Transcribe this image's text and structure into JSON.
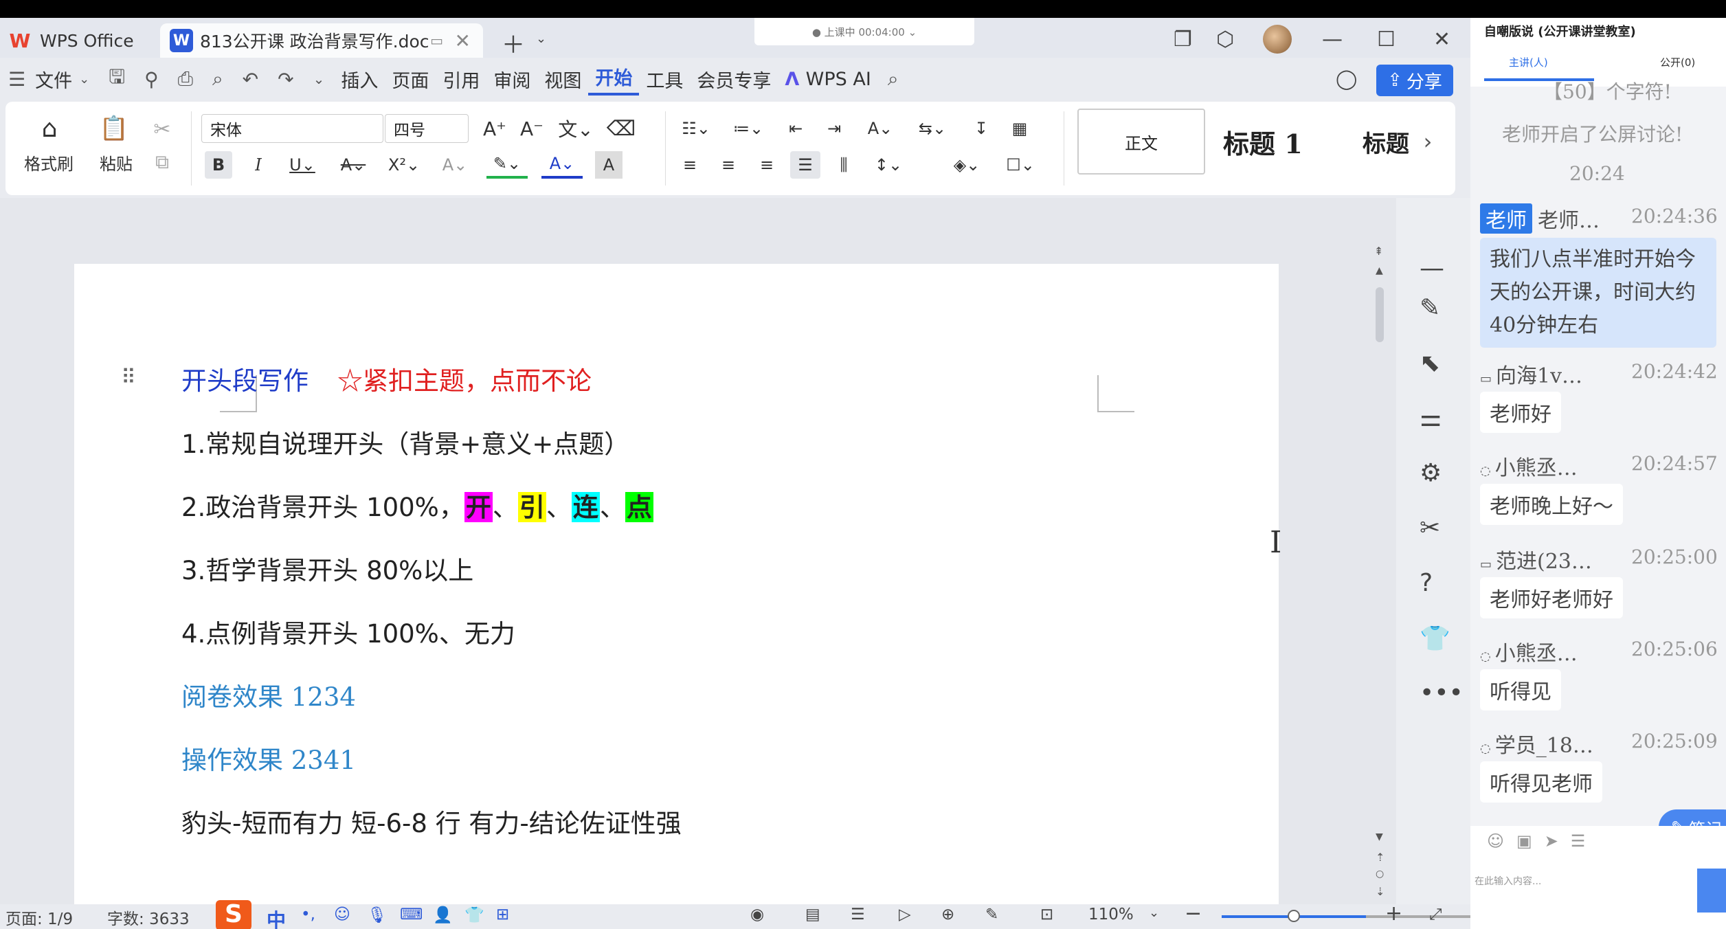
{
  "titlebar": {
    "home_tab": "WPS Office",
    "doc_tab": "813公开课 政治背景写作.doc",
    "timer": "● 上课中 00:04:00 ⌄"
  },
  "menu": {
    "file": "文件",
    "items": [
      "插入",
      "页面",
      "引用",
      "审阅",
      "视图",
      "开始",
      "工具",
      "会员专享"
    ],
    "active": "开始",
    "ai": "WPS AI",
    "share": "分享"
  },
  "ribbon": {
    "format_painter": "格式刷",
    "paste": "粘贴",
    "font_name": "宋体",
    "font_size": "四号",
    "style_normal": "正文",
    "style_h1": "标题 1",
    "style_h": "标题"
  },
  "document": {
    "heading_blue": "开头段写作",
    "heading_red": "☆紧扣主题，点而不论",
    "line1": "1.常规自说理开头（背景+意义+点题）",
    "line2_prefix": "2.政治背景开头 100%，",
    "hl1": "开",
    "hl2": "引",
    "hl3": "连",
    "hl4": "点",
    "sep": "、",
    "line3": "3.哲学背景开头 80%以上",
    "line4": "4.点例背景开头 100%、无力",
    "line5": "阅卷效果 1234",
    "line6": "操作效果 2341",
    "line7": "豹头-短而有力  短-6-8 行    有力-结论佐证性强"
  },
  "statusbar": {
    "page": "页面: 1/9",
    "words": "字数: 3633",
    "zoom": "110%",
    "ime": "中"
  },
  "zoom_level_fraction": 0.5,
  "chat": {
    "header_title": "自嘲版说 (公开课讲堂教室)",
    "tab_left": "主讲(人)",
    "tab_right": "公开(0)",
    "sys1": "【50】个字符!",
    "sys2": "老师开启了公屏讨论!",
    "sys_time": "20:24",
    "teacher_badge": "老师",
    "messages": [
      {
        "name": "老师…",
        "time": "20:24:36",
        "text": "我们八点半准时开始今天的公开课，时间大约40分钟左右"
      },
      {
        "name": "向海1v…",
        "time": "20:24:42",
        "text": "老师好"
      },
      {
        "name": "小熊丞…",
        "time": "20:24:57",
        "text": "老师晚上好～"
      },
      {
        "name": "范进(23…",
        "time": "20:25:00",
        "text": "老师好老师好"
      },
      {
        "name": "小熊丞…",
        "time": "20:25:06",
        "text": "听得见"
      },
      {
        "name": "学员_18…",
        "time": "20:25:09",
        "text": "听得见老师"
      }
    ],
    "note_button": "笔记",
    "input_placeholder": "在此输入内容..."
  },
  "colors": {
    "accent": "#2e6fe6",
    "heading_blue": "#1f3cc8",
    "heading_red": "#e02020",
    "teal_text": "#2f86c9",
    "hl_magenta": "#ff00ff",
    "hl_yellow": "#ffff00",
    "hl_cyan": "#00ffff",
    "hl_green": "#00ff00"
  }
}
